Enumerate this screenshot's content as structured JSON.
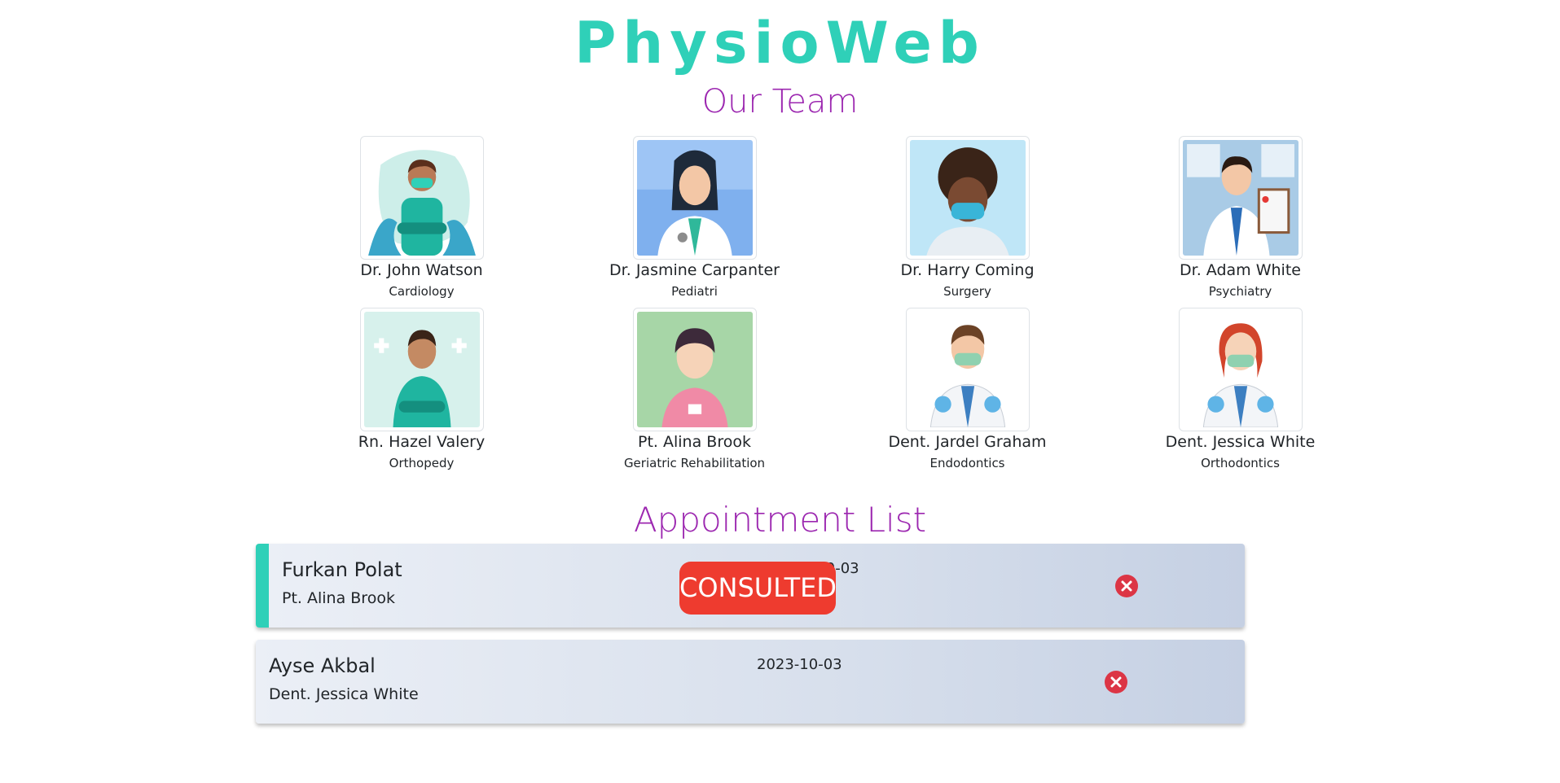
{
  "app": {
    "title": "PhysioWeb"
  },
  "team": {
    "title": "Our Team",
    "members": [
      {
        "name": "Dr. John Watson",
        "department": "Cardiology"
      },
      {
        "name": "Dr. Jasmine Carpanter",
        "department": "Pediatri"
      },
      {
        "name": "Dr. Harry Coming",
        "department": "Surgery"
      },
      {
        "name": "Dr. Adam White",
        "department": "Psychiatry"
      },
      {
        "name": "Rn. Hazel Valery",
        "department": "Orthopedy"
      },
      {
        "name": "Pt. Alina Brook",
        "department": "Geriatric Rehabilitation"
      },
      {
        "name": "Dent. Jardel Graham",
        "department": "Endodontics"
      },
      {
        "name": "Dent. Jessica White",
        "department": "Orthodontics"
      }
    ]
  },
  "appointments": {
    "title": "Appointment List",
    "items": [
      {
        "patient": "Furkan Polat",
        "doctor": "Pt. Alina Brook",
        "date": "2023-10-03",
        "status": "CONSULTED"
      },
      {
        "patient": "Ayse Akbal",
        "doctor": "Dent. Jessica White",
        "date": "2023-10-03"
      }
    ]
  },
  "icons": {
    "delete": "close-circle-icon"
  },
  "colors": {
    "brand": "#2fd0b8",
    "heading": "#9c27b0",
    "danger": "#dc3545",
    "badge": "#ee3b2f"
  }
}
